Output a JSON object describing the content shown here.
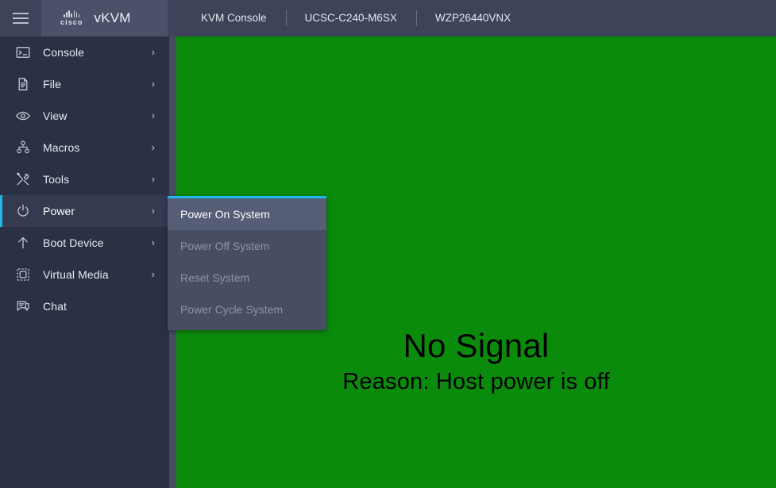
{
  "header": {
    "menu_toggle_icon": "hamburger-icon",
    "brand": {
      "vendor": "cisco",
      "product": "vKVM"
    },
    "tabs": [
      {
        "label": "KVM Console"
      },
      {
        "label": "UCSC-C240-M6SX"
      },
      {
        "label": "WZP26440VNX"
      }
    ]
  },
  "sidebar": {
    "items": [
      {
        "label": "Console",
        "icon": "terminal-icon",
        "chevron": "›",
        "has_submenu": true,
        "active": false
      },
      {
        "label": "File",
        "icon": "document-icon",
        "chevron": "›",
        "has_submenu": true,
        "active": false
      },
      {
        "label": "View",
        "icon": "eye-icon",
        "chevron": "›",
        "has_submenu": true,
        "active": false
      },
      {
        "label": "Macros",
        "icon": "sitemap-icon",
        "chevron": "›",
        "has_submenu": true,
        "active": false
      },
      {
        "label": "Tools",
        "icon": "tools-icon",
        "chevron": "›",
        "has_submenu": true,
        "active": false
      },
      {
        "label": "Power",
        "icon": "power-icon",
        "chevron": "›",
        "has_submenu": true,
        "active": true
      },
      {
        "label": "Boot Device",
        "icon": "arrow-up-icon",
        "chevron": "›",
        "has_submenu": true,
        "active": false
      },
      {
        "label": "Virtual Media",
        "icon": "virtual-media-icon",
        "chevron": "›",
        "has_submenu": true,
        "active": false
      },
      {
        "label": "Chat",
        "icon": "chat-bubble-icon",
        "chevron": "",
        "has_submenu": false,
        "active": false
      }
    ]
  },
  "power_submenu": {
    "parent": "Power",
    "items": [
      {
        "label": "Power On System",
        "enabled": true
      },
      {
        "label": "Power Off System",
        "enabled": false
      },
      {
        "label": "Reset System",
        "enabled": false
      },
      {
        "label": "Power Cycle System",
        "enabled": false
      }
    ]
  },
  "canvas": {
    "background_color": "#0b8b0b",
    "message_title": "No Signal",
    "message_reason": "Reason: Host power is off"
  },
  "colors": {
    "header_bg": "#3d4358",
    "brand_bg": "#4b5169",
    "sidebar_bg": "#2b3145",
    "sidebar_active_bg": "#343b51",
    "accent_cyan": "#1fb6e8",
    "submenu_bg": "#474d63",
    "submenu_highlight_bg": "#565d76",
    "submenu_disabled_text": "#8d93a8",
    "rail_bg": "#464c64",
    "screen_green": "#0b8b0b"
  }
}
